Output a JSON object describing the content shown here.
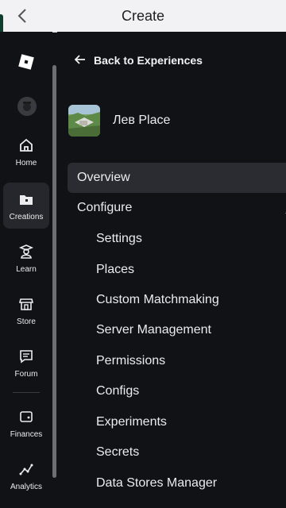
{
  "topbar": {
    "title": "Create",
    "back_icon": "chevron-left-icon"
  },
  "rail": {
    "logo_icon": "roblox-logo-icon",
    "avatar_icon": "user-avatar-icon",
    "items": [
      {
        "label": "Home",
        "icon": "home-icon",
        "active": false
      },
      {
        "label": "Creations",
        "icon": "creations-icon",
        "active": true
      },
      {
        "label": "Learn",
        "icon": "learn-icon",
        "active": false
      },
      {
        "label": "Store",
        "icon": "store-icon",
        "active": false
      },
      {
        "label": "Forum",
        "icon": "forum-icon",
        "active": false
      },
      {
        "label": "Finances",
        "icon": "wallet-icon",
        "active": false
      },
      {
        "label": "Analytics",
        "icon": "analytics-icon",
        "active": false
      }
    ]
  },
  "main": {
    "back_link": "Back to Experiences",
    "place_name": "Лев Place",
    "menu": [
      {
        "label": "Overview",
        "selected": true,
        "sub": false
      },
      {
        "label": "Configure",
        "selected": false,
        "sub": false,
        "expanded": true
      },
      {
        "label": "Settings",
        "selected": false,
        "sub": true
      },
      {
        "label": "Places",
        "selected": false,
        "sub": true
      },
      {
        "label": "Custom Matchmaking",
        "selected": false,
        "sub": true
      },
      {
        "label": "Server Management",
        "selected": false,
        "sub": true
      },
      {
        "label": "Permissions",
        "selected": false,
        "sub": true
      },
      {
        "label": "Configs",
        "selected": false,
        "sub": true
      },
      {
        "label": "Experiments",
        "selected": false,
        "sub": true
      },
      {
        "label": "Secrets",
        "selected": false,
        "sub": true
      },
      {
        "label": "Data Stores Manager",
        "selected": false,
        "sub": true
      }
    ]
  },
  "colors": {
    "background": "#111216",
    "topbar": "#f2f2f4",
    "selected": "#2b2c32"
  }
}
